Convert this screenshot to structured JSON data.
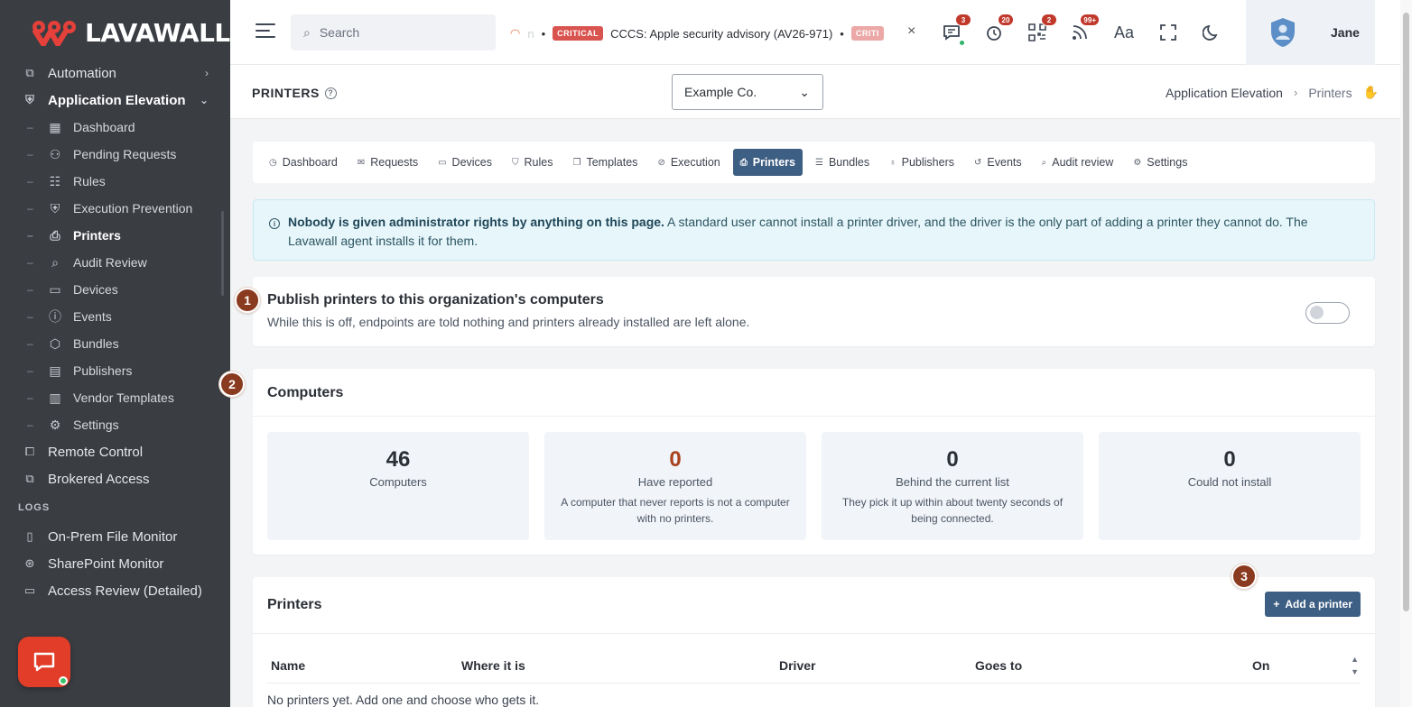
{
  "brand": {
    "name_red": "LAVA",
    "name_white": "WALL",
    "reg": "®"
  },
  "sidebar": {
    "top_items": [
      {
        "label": "Automation",
        "icon": "automation-icon"
      },
      {
        "label": "Application Elevation",
        "icon": "shield-icon"
      }
    ],
    "sub_items": [
      {
        "label": "Dashboard",
        "icon": "dashboard-icon"
      },
      {
        "label": "Pending Requests",
        "icon": "pending-icon"
      },
      {
        "label": "Rules",
        "icon": "rules-icon"
      },
      {
        "label": "Execution Prevention",
        "icon": "lock-shield-icon"
      },
      {
        "label": "Printers",
        "icon": "printer-icon"
      },
      {
        "label": "Audit Review",
        "icon": "audit-icon"
      },
      {
        "label": "Devices",
        "icon": "devices-icon"
      },
      {
        "label": "Events",
        "icon": "events-icon"
      },
      {
        "label": "Bundles",
        "icon": "bundles-icon"
      },
      {
        "label": "Publishers",
        "icon": "publishers-icon"
      },
      {
        "label": "Vendor Templates",
        "icon": "templates-icon"
      },
      {
        "label": "Settings",
        "icon": "gear-icon"
      }
    ],
    "after_items": [
      {
        "label": "Remote Control",
        "icon": "remote-icon"
      },
      {
        "label": "Brokered Access",
        "icon": "brokered-icon"
      }
    ],
    "logs_label": "LOGS",
    "log_items": [
      {
        "label": "On-Prem File Monitor",
        "icon": "file-monitor-icon"
      },
      {
        "label": "SharePoint Monitor",
        "icon": "sharepoint-icon"
      },
      {
        "label": "Access Review (Detailed)",
        "icon": "access-review-icon"
      }
    ]
  },
  "topbar": {
    "search_placeholder": "Search",
    "ticker_fade_text": "n",
    "ticker_badge": "CRITICAL",
    "ticker_text": "CCCS: Apple security advisory (AV26-971)",
    "ticker_badge_faded": "CRITI",
    "badges": {
      "messages": "3",
      "notifications": "20",
      "qr": "2",
      "feeds": "99+"
    },
    "user_name": "Jane"
  },
  "page": {
    "title": "PRINTERS",
    "org_selected": "Example Co.",
    "breadcrumb": [
      "Application Elevation",
      "Printers"
    ]
  },
  "tabs": [
    {
      "label": "Dashboard",
      "icon": "◷"
    },
    {
      "label": "Requests",
      "icon": "✉"
    },
    {
      "label": "Devices",
      "icon": "▭"
    },
    {
      "label": "Rules",
      "icon": "⛉"
    },
    {
      "label": "Templates",
      "icon": "❐"
    },
    {
      "label": "Execution",
      "icon": "⊘"
    },
    {
      "label": "Printers",
      "icon": "⎙"
    },
    {
      "label": "Bundles",
      "icon": "☰"
    },
    {
      "label": "Publishers",
      "icon": "♁"
    },
    {
      "label": "Events",
      "icon": "↺"
    },
    {
      "label": "Audit review",
      "icon": "⌕"
    },
    {
      "label": "Settings",
      "icon": "⚙"
    }
  ],
  "info": {
    "bold": "Nobody is given administrator rights by anything on this page.",
    "text": " A standard user cannot install a printer driver, and the driver is the only part of adding a printer they cannot do. The Lavawall agent installs it for them."
  },
  "publish": {
    "step": "1",
    "title": "Publish printers to this organization's computers",
    "subtitle": "While this is off, endpoints are told nothing and printers already installed are left alone.",
    "enabled": false
  },
  "computers": {
    "step": "2",
    "title": "Computers",
    "stats": [
      {
        "value": "46",
        "label": "Computers",
        "note": ""
      },
      {
        "value": "0",
        "label": "Have reported",
        "note": "A computer that never reports is not a computer with no printers."
      },
      {
        "value": "0",
        "label": "Behind the current list",
        "note": "They pick it up within about twenty seconds of being connected."
      },
      {
        "value": "0",
        "label": "Could not install",
        "note": ""
      }
    ]
  },
  "printers": {
    "step": "3",
    "title": "Printers",
    "add_label": "Add a printer",
    "columns": [
      "Name",
      "Where it is",
      "Driver",
      "Goes to",
      "On"
    ],
    "empty_text": "No printers yet. Add one and choose who gets it."
  },
  "colors": {
    "accent": "#3e5f84",
    "sidebar": "#3a3d42",
    "step": "#8a3a1e",
    "critical": "#d9534f"
  }
}
